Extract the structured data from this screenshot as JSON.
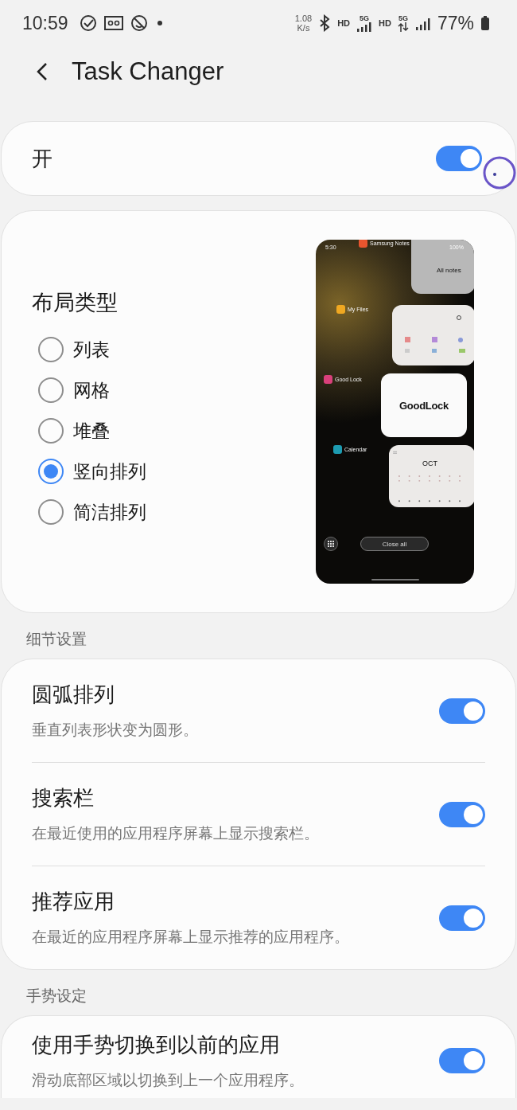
{
  "status_bar": {
    "time": "10:59",
    "net_speed": "1.08",
    "net_unit": "K/s",
    "hd_1": "HD",
    "net_1": "5G",
    "hd_2": "HD",
    "net_2": "5G",
    "battery": "77%"
  },
  "header": {
    "title": "Task Changer"
  },
  "master_switch": {
    "label": "开",
    "on": true
  },
  "layout_type": {
    "title": "布局类型",
    "options": [
      {
        "label": "列表",
        "selected": false
      },
      {
        "label": "网格",
        "selected": false
      },
      {
        "label": "堆叠",
        "selected": false
      },
      {
        "label": "竖向排列",
        "selected": true
      },
      {
        "label": "简洁排列",
        "selected": false
      }
    ],
    "preview": {
      "time": "5:30",
      "battery": "100%",
      "apps": [
        {
          "name": "Samsung Notes",
          "kind": "notes",
          "content": "All notes"
        },
        {
          "name": "My Files",
          "kind": "files"
        },
        {
          "name": "Good Lock",
          "kind": "goodlock",
          "content": "GoodLock"
        },
        {
          "name": "Calendar",
          "kind": "calendar",
          "content": "OCT"
        }
      ],
      "close_all": "Close all"
    }
  },
  "sections": [
    {
      "title": "细节设置",
      "items": [
        {
          "title": "圆弧排列",
          "description": "垂直列表形状变为圆形。",
          "on": true
        },
        {
          "title": "搜索栏",
          "description": "在最近使用的应用程序屏幕上显示搜索栏。",
          "on": true
        },
        {
          "title": "推荐应用",
          "description": "在最近的应用程序屏幕上显示推荐的应用程序。",
          "on": true
        }
      ]
    },
    {
      "title": "手势设定",
      "items": [
        {
          "title": "使用手势切换到以前的应用",
          "description": "滑动底部区域以切换到上一个应用程序。",
          "on": true
        }
      ]
    }
  ]
}
